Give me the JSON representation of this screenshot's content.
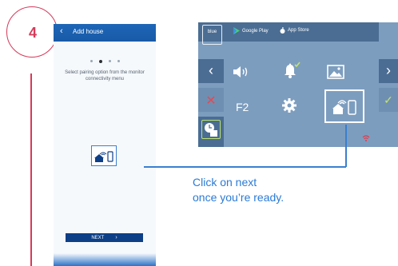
{
  "step": {
    "number": "4"
  },
  "phone": {
    "back_glyph": "‹",
    "title": "Add house",
    "pagination": {
      "pages": 4,
      "active": 2
    },
    "instruction": "Select pairing option from the monitor connectivity menu",
    "next_label": "NEXT",
    "illustration_icons": [
      "house-icon",
      "wifi-icon",
      "smartphone-icon"
    ]
  },
  "monitor": {
    "logo_text": "blue",
    "badges": {
      "google_play": "Google Play",
      "app_store": "App Store"
    },
    "nav": {
      "back": "‹",
      "next": "›",
      "cancel": "✕",
      "confirm": "✓"
    },
    "icons": [
      "volume-icon",
      "bell-icon",
      "gallery-icon",
      "settings-icon",
      "connectivity-icon"
    ],
    "f2_label": "F2",
    "colors": {
      "panel": "#7d9dbf",
      "bar": "#4b6d93",
      "cancel": "#e44953",
      "confirm": "#c3e36a",
      "wifi_alert": "#e33b4b"
    }
  },
  "caption": {
    "line1": "Click on next",
    "line2": "once you’re ready."
  },
  "colors": {
    "accent": "#d63a5a",
    "brand_blue": "#2a7ad6",
    "phone_header": "#1e66b8",
    "next_button": "#0d3f87"
  }
}
